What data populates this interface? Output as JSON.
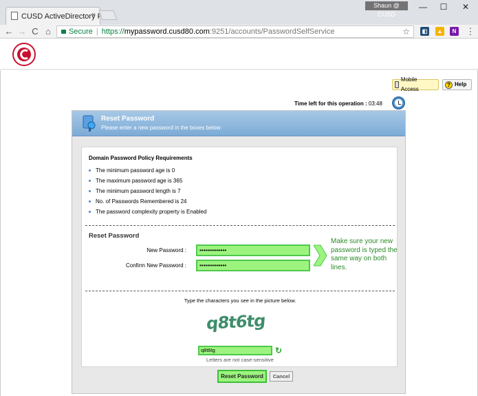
{
  "browser": {
    "tab_title": "CUSD ActiveDirectory Pa",
    "tab_close": "×",
    "user_badge": "Shaun @ CUSD",
    "window_controls": [
      "—",
      "☐",
      "✕"
    ],
    "nav": {
      "back": "←",
      "forward": "→",
      "reload": "C",
      "home": "⌂"
    },
    "address": {
      "secure_label": "Secure",
      "url_scheme": "https://",
      "url_host": "mypassword.cusd80.com",
      "url_rest": ":9251/accounts/PasswordSelfService"
    },
    "extensions": [
      "extension-1",
      "drive-icon",
      "onenote-icon"
    ],
    "menu": "⋮"
  },
  "site": {
    "logo_text": "CHANDLER UNIFIED SCHOOL DISTRICT"
  },
  "toolbar": {
    "mobile_label": "Mobile Access",
    "help_label": "Help"
  },
  "timer": {
    "label": "Time left for this operation :",
    "value": "03:48"
  },
  "panel": {
    "title": "Reset Password",
    "subtitle": "Please enter a new password in the boxes below:"
  },
  "policy": {
    "title": "Domain Password Policy Requirements",
    "items": [
      "The minimum password age is 0",
      "The maximum password age is 365",
      "The minimum password length is 7",
      "No. of Passwords Remembered is 24",
      "The password complexity property is Enabled"
    ]
  },
  "reset": {
    "title": "Reset Password",
    "new_label": "New Password :",
    "new_value": "••••••••••••••",
    "confirm_label": "Confirm New Password :",
    "confirm_value": "••••••••••••••"
  },
  "tip": {
    "text": "Make sure your new password is typed the same way on both lines."
  },
  "captcha": {
    "prompt": "Type the characters you see in the picture below.",
    "image_text": "q8t6tg",
    "value": "q8t6tg",
    "note": "Letters are not case-sensitive"
  },
  "buttons": {
    "reset_label": "Reset Password",
    "cancel_label": "Cancel"
  },
  "colors": {
    "highlight": "#9cf47e",
    "highlight_border": "#4fc84b",
    "panel_header": "#7cabd6",
    "tip_text": "#2a8a28"
  }
}
